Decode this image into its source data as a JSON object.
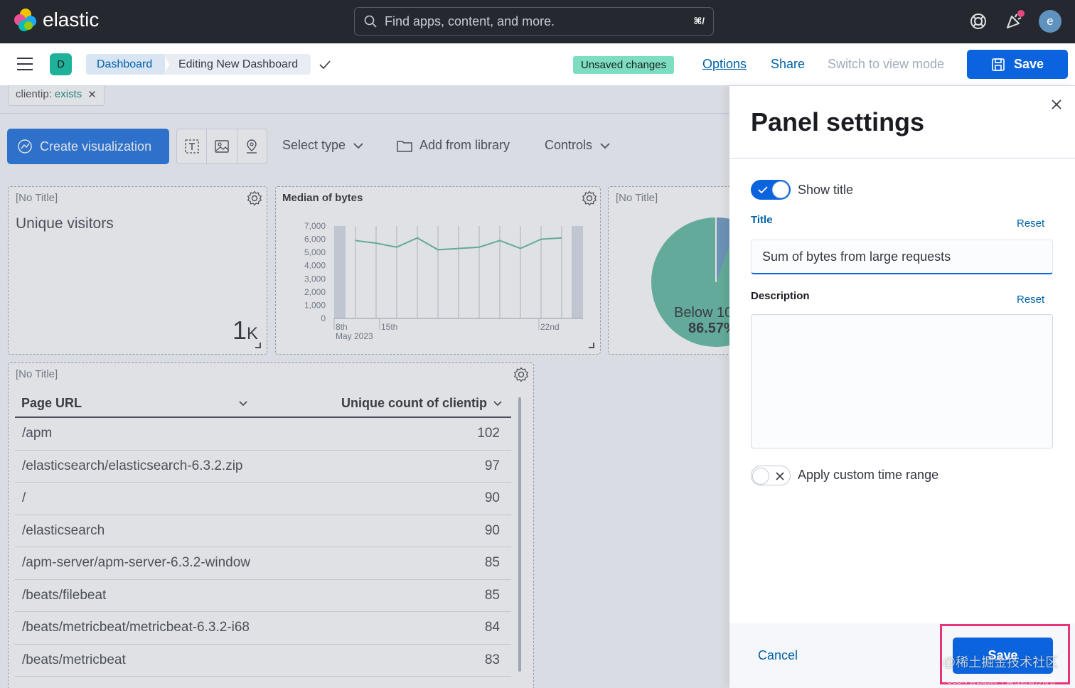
{
  "topbar": {
    "brand": "elastic",
    "search_placeholder": "Find apps, content, and more.",
    "search_shortcut": "⌘/",
    "avatar_initial": "e"
  },
  "navbar": {
    "space_initial": "D",
    "breadcrumbs": [
      "Dashboard",
      "Editing New Dashboard"
    ],
    "unsaved_badge": "Unsaved changes",
    "options_label": "Options",
    "share_label": "Share",
    "view_mode_label": "Switch to view mode",
    "save_label": "Save"
  },
  "filter": {
    "key": "clientip:",
    "value": "exists"
  },
  "toolbar": {
    "create_label": "Create visualization",
    "select_type_label": "Select type",
    "add_library_label": "Add from library",
    "controls_label": "Controls"
  },
  "panels": {
    "metric": {
      "title": "[No Title]",
      "label": "Unique visitors",
      "value": "1",
      "suffix": "K"
    },
    "line": {
      "title": "Median of bytes",
      "y_ticks": [
        "7,000",
        "6,000",
        "5,000",
        "4,000",
        "3,000",
        "2,000",
        "1,000",
        "0"
      ],
      "x_ticks": [
        "8th",
        "15th",
        "22nd"
      ],
      "x_sub": "May 2023"
    },
    "pie": {
      "title": "[No Title]",
      "label": "Below 10",
      "percent": "86.57%"
    },
    "table": {
      "title": "[No Title]",
      "columns": [
        "Page URL",
        "Unique count of clientip"
      ],
      "rows": [
        {
          "url": "/apm",
          "count": "102"
        },
        {
          "url": "/elasticsearch/elasticsearch-6.3.2.zip",
          "count": "97"
        },
        {
          "url": "/",
          "count": "90"
        },
        {
          "url": "/elasticsearch",
          "count": "90"
        },
        {
          "url": "/apm-server/apm-server-6.3.2-window",
          "count": "85"
        },
        {
          "url": "/beats/filebeat",
          "count": "85"
        },
        {
          "url": "/beats/metricbeat/metricbeat-6.3.2-i68",
          "count": "84"
        },
        {
          "url": "/beats/metricbeat",
          "count": "83"
        }
      ]
    }
  },
  "chart_data": {
    "type": "line",
    "title": "Median of bytes",
    "x": [
      "May 3",
      "May 5",
      "May 7",
      "May 9",
      "May 11",
      "May 13",
      "May 15",
      "May 17",
      "May 19",
      "May 21",
      "May 23"
    ],
    "values": [
      5900,
      5700,
      5400,
      6100,
      5200,
      5300,
      5400,
      5900,
      5300,
      6000,
      6100
    ],
    "ylim": [
      0,
      7000
    ],
    "y_ticks": [
      0,
      1000,
      2000,
      3000,
      4000,
      5000,
      6000,
      7000
    ],
    "x_tick_labels": [
      "8th",
      "15th",
      "22nd"
    ],
    "x_sub_label": "May 2023",
    "line_color": "#54b399"
  },
  "flyout": {
    "title": "Panel settings",
    "show_title_label": "Show title",
    "title_field_label": "Title",
    "title_value": "Sum of bytes from large requests",
    "reset_label": "Reset",
    "description_label": "Description",
    "custom_time_label": "Apply custom time range",
    "cancel_label": "Cancel",
    "save_label": "Save"
  },
  "watermark": {
    "main": "@稀土掘金技术社区",
    "sub": "CSDN @Elastic 中国社区官方博客"
  },
  "colors": {
    "primary": "#0b64dd",
    "link": "#0061a6",
    "success_badge": "#7dddc1",
    "highlight": "#e7347a"
  }
}
